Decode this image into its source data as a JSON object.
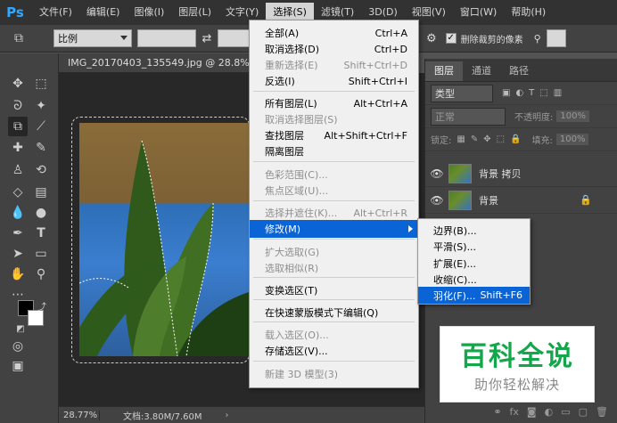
{
  "app": {
    "logo": "Ps"
  },
  "menubar": {
    "items": [
      "文件(F)",
      "编辑(E)",
      "图像(I)",
      "图层(L)",
      "文字(Y)",
      "选择(S)",
      "滤镜(T)",
      "3D(D)",
      "视图(V)",
      "窗口(W)",
      "帮助(H)"
    ],
    "active_index": 5
  },
  "options_bar": {
    "ratio_select": "比例",
    "delete_cropped_label": "删除裁剪的像素",
    "delete_cropped_checked": true
  },
  "document": {
    "tab_title": "IMG_20170403_135549.jpg @ 28.8%(RGB/",
    "zoom": "28.77%",
    "doc_info": "文档:3.80M/7.60M"
  },
  "select_menu": {
    "items": [
      {
        "label": "全部(A)",
        "shortcut": "Ctrl+A",
        "disabled": false
      },
      {
        "label": "取消选择(D)",
        "shortcut": "Ctrl+D",
        "disabled": false
      },
      {
        "label": "重新选择(E)",
        "shortcut": "Shift+Ctrl+D",
        "disabled": true
      },
      {
        "label": "反选(I)",
        "shortcut": "Shift+Ctrl+I",
        "disabled": false
      },
      {
        "label": "所有图层(L)",
        "shortcut": "Alt+Ctrl+A",
        "disabled": false
      },
      {
        "label": "取消选择图层(S)",
        "shortcut": "",
        "disabled": true
      },
      {
        "label": "查找图层",
        "shortcut": "Alt+Shift+Ctrl+F",
        "disabled": false
      },
      {
        "label": "隔离图层",
        "shortcut": "",
        "disabled": false
      },
      {
        "label": "色彩范围(C)...",
        "shortcut": "",
        "disabled": true
      },
      {
        "label": "焦点区域(U)...",
        "shortcut": "",
        "disabled": true
      },
      {
        "label": "选择并遮住(K)...",
        "shortcut": "Alt+Ctrl+R",
        "disabled": true
      },
      {
        "label": "修改(M)",
        "shortcut": "",
        "disabled": false,
        "highlighted": true
      },
      {
        "label": "扩大选取(G)",
        "shortcut": "",
        "disabled": true
      },
      {
        "label": "选取相似(R)",
        "shortcut": "",
        "disabled": true
      },
      {
        "label": "变换选区(T)",
        "shortcut": "",
        "disabled": false
      },
      {
        "label": "在快速蒙版模式下编辑(Q)",
        "shortcut": "",
        "disabled": false
      },
      {
        "label": "载入选区(O)...",
        "shortcut": "",
        "disabled": true
      },
      {
        "label": "存储选区(V)...",
        "shortcut": "",
        "disabled": false
      },
      {
        "label": "新建 3D 模型(3)",
        "shortcut": "",
        "disabled": true
      }
    ]
  },
  "modify_submenu": {
    "items": [
      {
        "label": "边界(B)...",
        "shortcut": ""
      },
      {
        "label": "平滑(S)...",
        "shortcut": ""
      },
      {
        "label": "扩展(E)...",
        "shortcut": ""
      },
      {
        "label": "收缩(C)...",
        "shortcut": ""
      },
      {
        "label": "羽化(F)...",
        "shortcut": "Shift+F6",
        "highlighted": true
      }
    ]
  },
  "layers_panel": {
    "tabs": [
      "图层",
      "通道",
      "路径"
    ],
    "filter_kind": "类型",
    "blend_mode": "正常",
    "opacity_label": "不透明度:",
    "opacity_value": "100%",
    "lock_label": "锁定:",
    "fill_label": "填充:",
    "fill_value": "100%",
    "layers": [
      {
        "name": "背景 拷贝",
        "locked": false
      },
      {
        "name": "背景",
        "locked": true
      }
    ]
  },
  "watermark": {
    "title": "百科全说",
    "subtitle": "助你轻松解决"
  },
  "colors": {
    "accent_blue": "#0a64d6",
    "brand_green": "#14a64a",
    "ps_blue": "#31a8ff"
  }
}
